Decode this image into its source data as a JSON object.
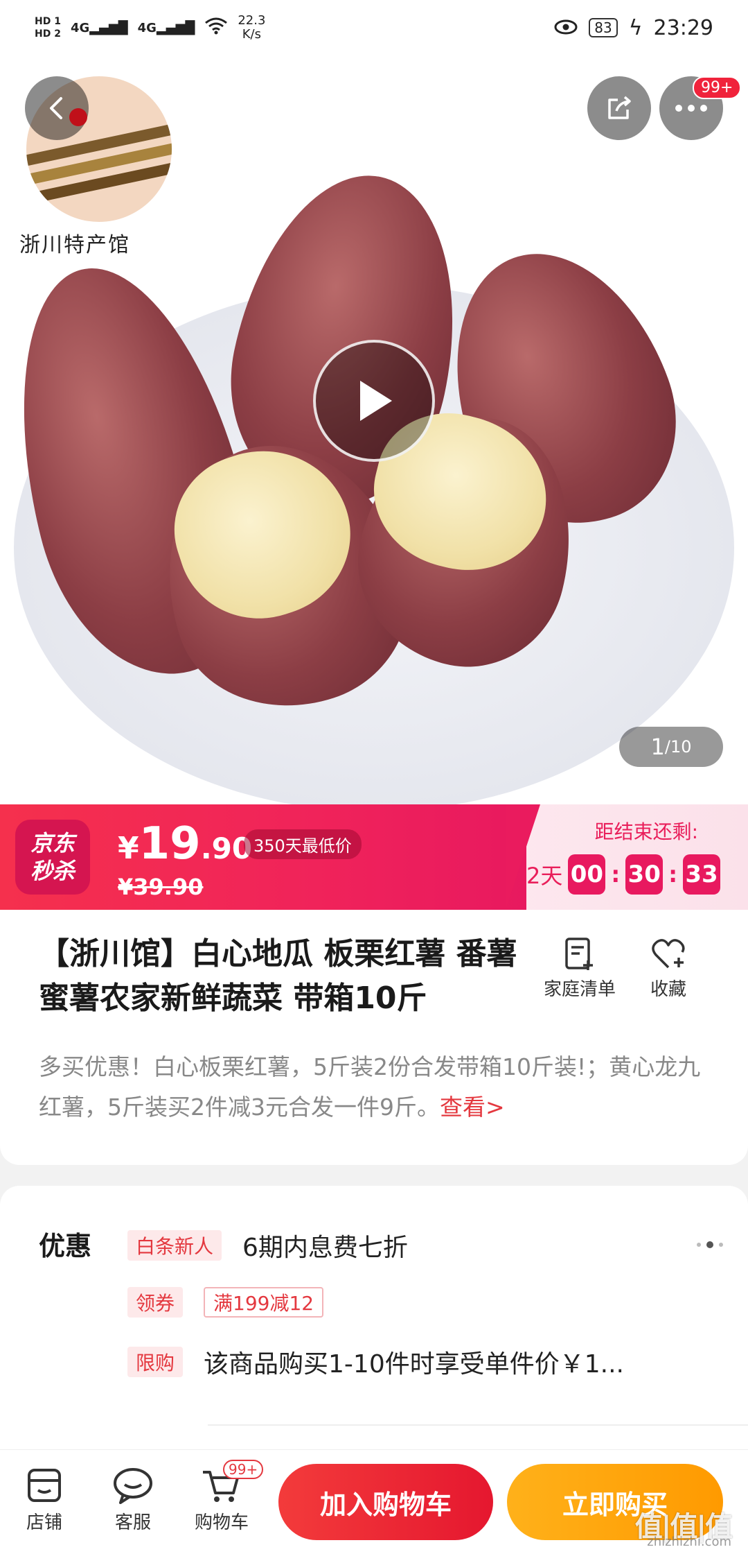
{
  "status_bar": {
    "hd1": "HD 1",
    "hd2": "HD 2",
    "signal1": "4G",
    "signal2": "4G",
    "speed_value": "22.3",
    "speed_unit": "K/s",
    "battery": "83",
    "time": "23:29"
  },
  "hero": {
    "shop_logo_text": "浙川特产馆",
    "more_badge": "99+",
    "counter_current": "1",
    "counter_total": "/10"
  },
  "seckill": {
    "logo_line1": "京东",
    "logo_line2": "秒杀",
    "price_symbol": "¥",
    "price_int": "19",
    "price_dec": ".90",
    "low_price_tag": "350天最低价",
    "original_price": "¥39.90",
    "countdown_label": "距结束还剩:",
    "days": "2天",
    "hours": "00",
    "minutes": "30",
    "seconds": "33",
    "separator": ":"
  },
  "product": {
    "title": "【浙川馆】白心地瓜 板栗红薯 番薯蜜薯农家新鲜蔬菜 带箱10斤",
    "family_list_label": "家庭清单",
    "favorite_label": "收藏",
    "promo_text": "多买优惠！白心板栗红薯，5斤装2份合发带箱10斤装!；黄心龙九红薯，5斤装买2件减3元合发一件9斤。",
    "promo_link": "查看>"
  },
  "offers": {
    "title": "优惠",
    "rows": [
      {
        "tag": "白条新人",
        "text": "6期内息费七折"
      },
      {
        "tag": "领券",
        "text": "满199减12"
      },
      {
        "tag": "限购",
        "text": "该商品购买1-10件时享受单件价￥1..."
      }
    ]
  },
  "bottom_bar": {
    "shop_label": "店铺",
    "service_label": "客服",
    "cart_label": "购物车",
    "cart_badge": "99+",
    "add_to_cart": "加入购物车",
    "buy_now": "立即购买"
  },
  "watermark": {
    "big": "值|值|值",
    "small": "zhizhizhi.com"
  },
  "colors": {
    "accent_red": "#e4383f",
    "seckill_pink": "#e8195f",
    "buy_orange": "#ff9a00"
  }
}
